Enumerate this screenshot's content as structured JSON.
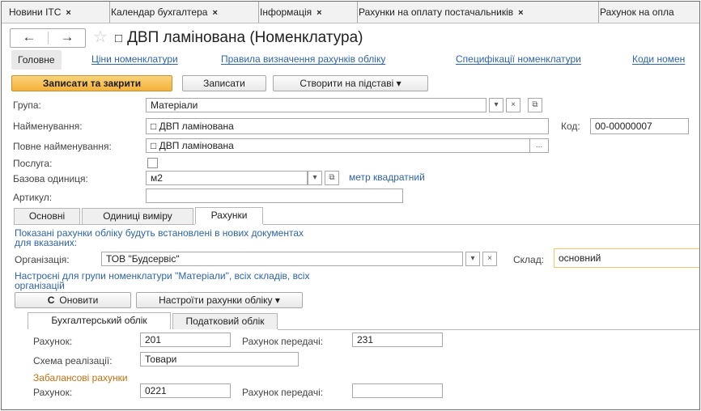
{
  "tabs": [
    {
      "label": "Новини ІТС"
    },
    {
      "label": "Календар бухгалтера"
    },
    {
      "label": "Інформація"
    },
    {
      "label": "Рахунки на оплату постачальників"
    },
    {
      "label": "Рахунок на опла"
    }
  ],
  "tab_close": "×",
  "nav": {
    "back": "←",
    "forward": "→",
    "star": "☆"
  },
  "header": {
    "checkbox_glyph": "□",
    "title": "ДВП ламінована (Номенклатура)"
  },
  "panel": {
    "main": "Головне",
    "links": [
      "Ціни номенклатури",
      "Правила визначення рахунків обліку",
      "Специфікації номенклатури",
      "Коди номен"
    ]
  },
  "toolbar": {
    "save_close": "Записати та закрити",
    "save": "Записати",
    "create_based": "Створити на підставі"
  },
  "form": {
    "group_label": "Група:",
    "group_value": "Матеріали",
    "name_label": "Найменування:",
    "name_value": "□ ДВП ламінована",
    "code_label": "Код:",
    "code_value": "00-00000007",
    "fullname_label": "Повне найменування:",
    "fullname_value": "□ ДВП ламінована",
    "service_label": "Послуга:",
    "unit_label": "Базова одиниця:",
    "unit_value": "м2",
    "unit_link": "метр квадратний",
    "article_label": "Артикул:",
    "article_value": ""
  },
  "form_tabs": [
    "Основні",
    "Одиниці виміру",
    "Рахунки"
  ],
  "accounts": {
    "info_line1": "Показані рахунки обліку будуть встановлені в нових документах",
    "info_line2": "для вказаних:",
    "org_label": "Організація:",
    "org_value": "ТОВ \"Будсервіс\"",
    "warehouse_label": "Склад:",
    "warehouse_value": "основний",
    "note_line1": "Настроєні для групи номенклатури \"Матеріали\", всіх складів, всіх",
    "note_line2": "організацій",
    "refresh": "Оновити",
    "refresh_icon": "C",
    "setup": "Настроїти рахунки обліку"
  },
  "sub_tabs": [
    "Бухгалтерський облік",
    "Податковий облік"
  ],
  "accounting": {
    "account_label": "Рахунок:",
    "account_value": "201",
    "transfer_label": "Рахунок передачі:",
    "transfer_value": "231",
    "scheme_label": "Схема реалізації:",
    "scheme_value": "Товари",
    "offbalance_title": "Забалансові рахунки",
    "offbalance_account_label": "Рахунок:",
    "offbalance_account_value": "0221",
    "offbalance_transfer_label": "Рахунок передачі:",
    "offbalance_transfer_value": ""
  },
  "glyphs": {
    "dropdown": "▾",
    "clear": "×",
    "open": "⧉",
    "ellipsis": "..."
  }
}
